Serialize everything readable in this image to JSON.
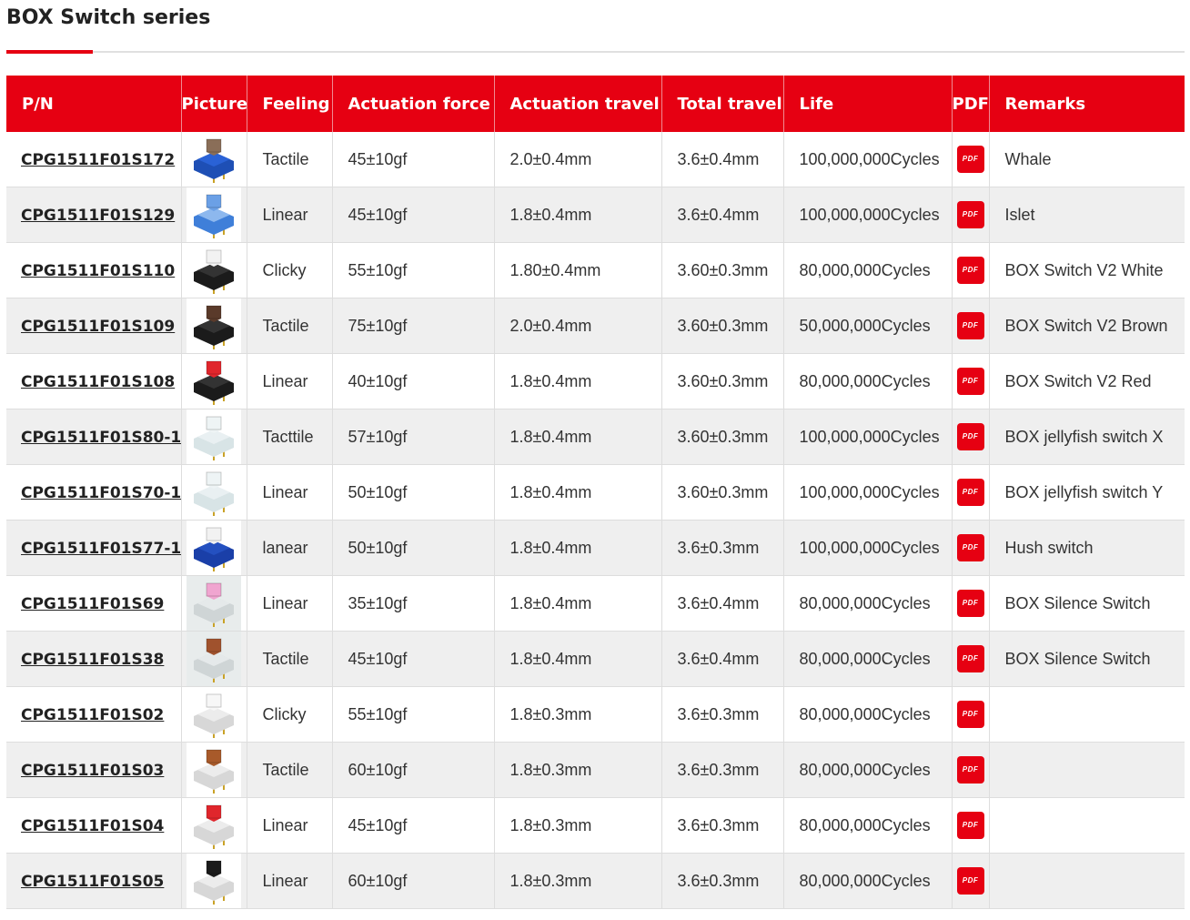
{
  "page": {
    "title": "BOX Switch series"
  },
  "colors": {
    "accent": "#e60012",
    "row_alt": "#efefef"
  },
  "table": {
    "headers": [
      "P/N",
      "Picture",
      "Feeling",
      "Actuation force",
      "Actuation travel",
      "Total travel",
      "Life",
      "PDF",
      "Remarks"
    ],
    "pdf_label": "PDF",
    "rows": [
      {
        "pn": "CPG1511F01S172",
        "feeling": "Tactile",
        "force": "45±10gf",
        "act_travel": "2.0±0.4mm",
        "total_travel": "3.6±0.4mm",
        "life": "100,000,000Cycles",
        "remarks": "Whale",
        "img": {
          "bg": "#ffffff",
          "housing": "#1e4fb5",
          "top": "#2a62d6",
          "stem": "#8a6e58"
        }
      },
      {
        "pn": "CPG1511F01S129",
        "feeling": "Linear",
        "force": "45±10gf",
        "act_travel": "1.8±0.4mm",
        "total_travel": "3.6±0.4mm",
        "life": "100,000,000Cycles",
        "remarks": "Islet",
        "img": {
          "bg": "#ffffff",
          "housing": "#3f7fd9",
          "top": "#8db8ee",
          "stem": "#6ba0e6"
        }
      },
      {
        "pn": "CPG1511F01S110",
        "feeling": "Clicky",
        "force": "55±10gf",
        "act_travel": "1.80±0.4mm",
        "total_travel": "3.60±0.3mm",
        "life": "80,000,000Cycles",
        "remarks": "BOX Switch V2 White",
        "img": {
          "bg": "#ffffff",
          "housing": "#1b1b1b",
          "top": "#333333",
          "stem": "#f2f2f2"
        }
      },
      {
        "pn": "CPG1511F01S109",
        "feeling": "Tactile",
        "force": "75±10gf",
        "act_travel": "2.0±0.4mm",
        "total_travel": "3.60±0.3mm",
        "life": "50,000,000Cycles",
        "remarks": "BOX Switch V2 Brown",
        "img": {
          "bg": "#ffffff",
          "housing": "#1b1b1b",
          "top": "#333333",
          "stem": "#5a3a2a"
        }
      },
      {
        "pn": "CPG1511F01S108",
        "feeling": "Linear",
        "force": "40±10gf",
        "act_travel": "1.8±0.4mm",
        "total_travel": "3.60±0.3mm",
        "life": "80,000,000Cycles",
        "remarks": "BOX Switch V2 Red",
        "img": {
          "bg": "#ffffff",
          "housing": "#1b1b1b",
          "top": "#333333",
          "stem": "#e0262c"
        }
      },
      {
        "pn": "CPG1511F01S80-1",
        "feeling": "Tacttile",
        "force": "57±10gf",
        "act_travel": "1.8±0.4mm",
        "total_travel": "3.60±0.3mm",
        "life": "100,000,000Cycles",
        "remarks": "BOX jellyfish switch X",
        "img": {
          "bg": "#ffffff",
          "housing": "#d8e4e6",
          "top": "#e9f0f2",
          "stem": "#eef4f5"
        }
      },
      {
        "pn": "CPG1511F01S70-1",
        "feeling": "Linear",
        "force": "50±10gf",
        "act_travel": "1.8±0.4mm",
        "total_travel": "3.60±0.3mm",
        "life": "100,000,000Cycles",
        "remarks": "BOX jellyfish switch Y",
        "img": {
          "bg": "#ffffff",
          "housing": "#d8e4e6",
          "top": "#e9f0f2",
          "stem": "#eef4f5"
        }
      },
      {
        "pn": "CPG1511F01S77-1",
        "feeling": "lanear",
        "force": "50±10gf",
        "act_travel": "1.8±0.4mm",
        "total_travel": "3.6±0.3mm",
        "life": "100,000,000Cycles",
        "remarks": "Hush switch",
        "img": {
          "bg": "#ffffff",
          "housing": "#1a3fa8",
          "top": "#2450c0",
          "stem": "#f2f2f2"
        }
      },
      {
        "pn": "CPG1511F01S69",
        "feeling": "Linear",
        "force": "35±10gf",
        "act_travel": "1.8±0.4mm",
        "total_travel": "3.6±0.4mm",
        "life": "80,000,000Cycles",
        "remarks": "BOX Silence Switch",
        "img": {
          "bg": "#e8ecec",
          "housing": "#cfd5d6",
          "top": "#e5e9ea",
          "stem": "#f0a5d0"
        }
      },
      {
        "pn": "CPG1511F01S38",
        "feeling": "Tactile",
        "force": "45±10gf",
        "act_travel": "1.8±0.4mm",
        "total_travel": "3.6±0.4mm",
        "life": "80,000,000Cycles",
        "remarks": "BOX Silence Switch",
        "img": {
          "bg": "#e8ecec",
          "housing": "#cfd5d6",
          "top": "#e5e9ea",
          "stem": "#a0522d"
        }
      },
      {
        "pn": "CPG1511F01S02",
        "feeling": "Clicky",
        "force": "55±10gf",
        "act_travel": "1.8±0.3mm",
        "total_travel": "3.6±0.3mm",
        "life": "80,000,000Cycles",
        "remarks": "",
        "img": {
          "bg": "#ffffff",
          "housing": "#d7d7d7",
          "top": "#ececec",
          "stem": "#f7f7f7"
        }
      },
      {
        "pn": "CPG1511F01S03",
        "feeling": "Tactile",
        "force": "60±10gf",
        "act_travel": "1.8±0.3mm",
        "total_travel": "3.6±0.3mm",
        "life": "80,000,000Cycles",
        "remarks": "",
        "img": {
          "bg": "#ffffff",
          "housing": "#d7d7d7",
          "top": "#ececec",
          "stem": "#a85a2a"
        }
      },
      {
        "pn": "CPG1511F01S04",
        "feeling": "Linear",
        "force": "45±10gf",
        "act_travel": "1.8±0.3mm",
        "total_travel": "3.6±0.3mm",
        "life": "80,000,000Cycles",
        "remarks": "",
        "img": {
          "bg": "#ffffff",
          "housing": "#d7d7d7",
          "top": "#ececec",
          "stem": "#e0262c"
        }
      },
      {
        "pn": "CPG1511F01S05",
        "feeling": "Linear",
        "force": "60±10gf",
        "act_travel": "1.8±0.3mm",
        "total_travel": "3.6±0.3mm",
        "life": "80,000,000Cycles",
        "remarks": "",
        "img": {
          "bg": "#ffffff",
          "housing": "#d7d7d7",
          "top": "#ececec",
          "stem": "#1a1a1a"
        }
      }
    ]
  }
}
